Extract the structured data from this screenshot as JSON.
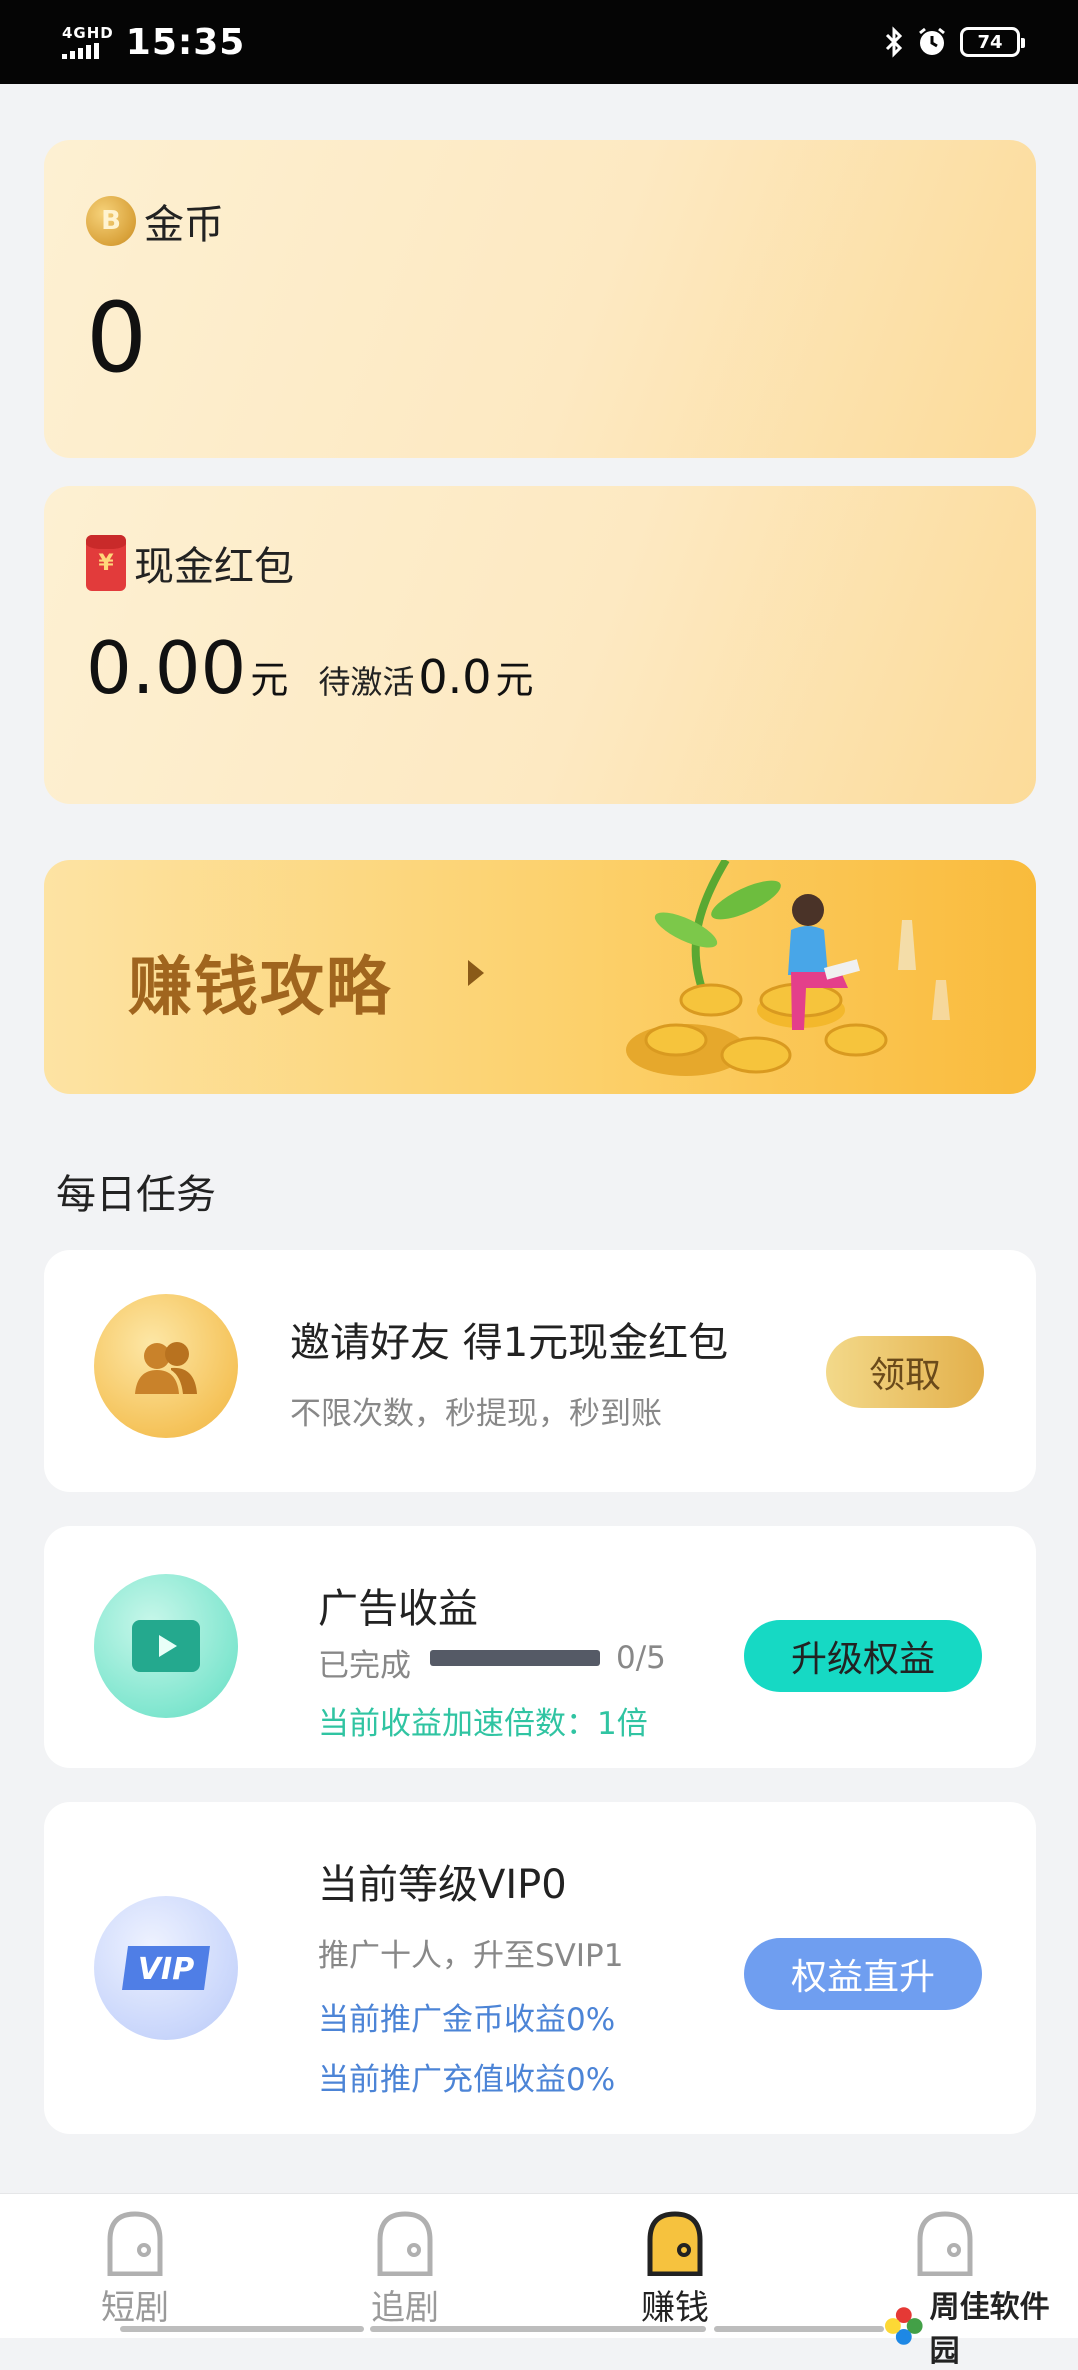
{
  "status_bar": {
    "network": "4GHD",
    "time": "15:35",
    "battery": "74"
  },
  "coins": {
    "label": "金币",
    "value": "0"
  },
  "cash": {
    "label": "现金红包",
    "amount": "0.00",
    "unit": "元",
    "pending_label": "待激活",
    "pending_amount": "0.0",
    "pending_unit": "元"
  },
  "banner": {
    "title": "赚钱攻略"
  },
  "daily_tasks": {
    "title": "每日任务",
    "invite": {
      "title": "邀请好友 得1元现金红包",
      "subtitle": "不限次数，秒提现，秒到账",
      "button": "领取"
    },
    "ads": {
      "title": "广告收益",
      "progress_label": "已完成",
      "progress_value": 0,
      "progress_max": 5,
      "progress_text": "0/5",
      "speed_text": "当前收益加速倍数：1倍",
      "button": "升级权益"
    },
    "vip": {
      "title": "当前等级VIP0",
      "subtitle": "推广十人，升至SVIP1",
      "coin_income": "当前推广金币收益0%",
      "recharge_income": "当前推广充值收益0%",
      "button": "权益直升",
      "badge": "VIP"
    }
  },
  "tabs": [
    {
      "label": "短剧",
      "active": false
    },
    {
      "label": "追剧",
      "active": false
    },
    {
      "label": "赚钱",
      "active": true
    },
    {
      "label": "",
      "active": false
    }
  ],
  "watermark": {
    "text": "周佳软件园"
  },
  "colors": {
    "gold": "#fde9c2",
    "teal": "#16d9c4",
    "blue": "#6f9ef0",
    "green_text": "#30c4a2",
    "blue_text": "#4c84d6"
  }
}
